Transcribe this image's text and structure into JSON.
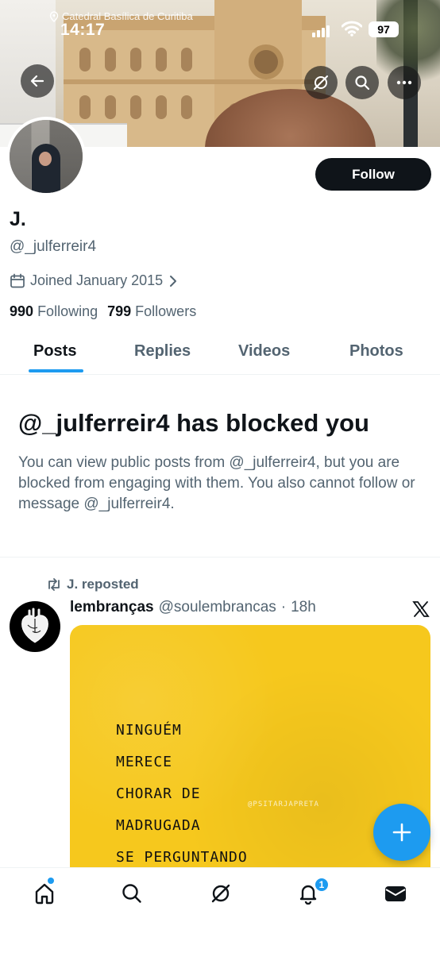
{
  "status_bar": {
    "location": "Catedral Basílica de Curitiba",
    "time": "14:17",
    "battery": "97"
  },
  "profile": {
    "display_name": "J.",
    "handle": "@_julferreir4",
    "joined": "Joined January 2015",
    "following_count": "990",
    "following_label": "Following",
    "followers_count": "799",
    "followers_label": "Followers",
    "follow_button": "Follow"
  },
  "tabs": [
    {
      "label": "Posts",
      "active": true
    },
    {
      "label": "Replies",
      "active": false
    },
    {
      "label": "Videos",
      "active": false
    },
    {
      "label": "Photos",
      "active": false
    }
  ],
  "blocked_notice": {
    "title": "@_julferreir4 has blocked you",
    "body": "You can view public posts from @_julferreir4, but you are blocked from engaging with them. You also cannot follow or message @_julferreir4."
  },
  "post": {
    "repost_label": "J. reposted",
    "author_name": "lembranças",
    "author_handle": "@soulembrancas",
    "separator": "·",
    "time": "18h",
    "image_lines": [
      "NINGUÉM",
      "MERECE",
      "CHORAR DE",
      "MADRUGADA",
      "SE PERGUNTANDO"
    ],
    "image_watermark": "@PSITARJAPRETA",
    "image_background": "#f6c81d"
  },
  "bottom_nav": {
    "notification_count": "1"
  },
  "colors": {
    "accent": "#1d9bf0",
    "text_primary": "#0f1419",
    "text_secondary": "#536471"
  }
}
